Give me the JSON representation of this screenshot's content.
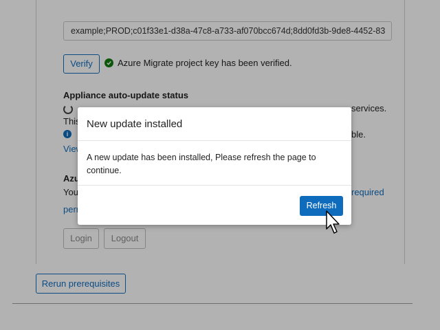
{
  "project_key": {
    "value": "example;PROD;c01f33e1-d38a-47c8-a733-af070bcc674d;8dd0fd3b-9de8-4452-83"
  },
  "verify": {
    "button_label": "Verify",
    "status_message": "Azure Migrate project key has been verified."
  },
  "auto_update": {
    "title": "Appliance auto-update status",
    "status_line_visible_right": "services.",
    "line2_visible": "This",
    "line3_visible_right": "ble.",
    "link_visible": "View"
  },
  "azure_section": {
    "heading_visible": "Azu",
    "line_visible_left": "You",
    "line_visible_right": "required",
    "line2_visible": "perr"
  },
  "auth_buttons": {
    "login_label": "Login",
    "logout_label": "Logout"
  },
  "rerun_button_label": "Rerun prerequisites",
  "modal": {
    "title": "New update installed",
    "message": "A new update has been installed, Please refresh the page to continue.",
    "refresh_label": "Refresh"
  },
  "colors": {
    "accent": "#0f6cbd",
    "success": "#107c10"
  }
}
